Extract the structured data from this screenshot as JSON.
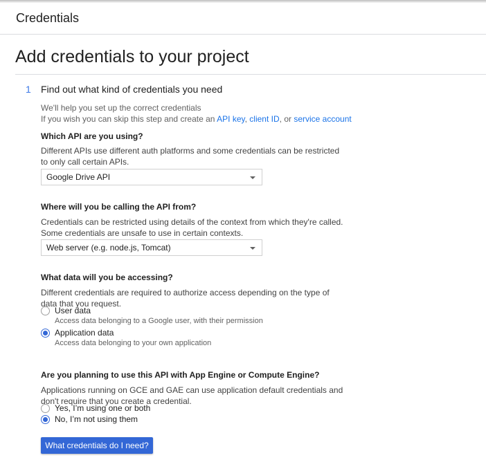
{
  "header": {
    "title": "Credentials"
  },
  "page": {
    "title": "Add credentials to your project"
  },
  "step": {
    "number": "1",
    "title": "Find out what kind of credentials you need"
  },
  "intro": {
    "line1": "We'll help you set up the correct credentials",
    "line2_prefix": "If you wish you can skip this step and create an ",
    "link_api_key": "API key",
    "sep1": ", ",
    "link_client_id": "client ID",
    "sep2": ", or ",
    "link_service_account": "service account"
  },
  "api_question": {
    "label": "Which API are you using?",
    "desc": "Different APIs use different auth platforms and some credentials can be restricted to only call certain APIs.",
    "selected": "Google Drive API"
  },
  "calling_question": {
    "label": "Where will you be calling the API from?",
    "desc": "Credentials can be restricted using details of the context from which they're called. Some credentials are unsafe to use in certain contexts.",
    "selected": "Web server (e.g. node.js, Tomcat)"
  },
  "data_question": {
    "label": "What data will you be accessing?",
    "desc": "Different credentials are required to authorize access depending on the type of data that you request.",
    "options": [
      {
        "label": "User data",
        "sub": "Access data belonging to a Google user, with their permission",
        "checked": false
      },
      {
        "label": "Application data",
        "sub": "Access data belonging to your own application",
        "checked": true
      }
    ]
  },
  "engine_question": {
    "label": "Are you planning to use this API with App Engine or Compute Engine?",
    "desc": "Applications running on GCE and GAE can use application default credentials and don't require that you create a credential.",
    "options": [
      {
        "label": "Yes, I’m using one or both",
        "checked": false
      },
      {
        "label": "No, I’m not using them",
        "checked": true
      }
    ]
  },
  "actions": {
    "primary_label": "What credentials do I need?"
  },
  "colors": {
    "accent": "#3367d6",
    "link": "#1a73e8",
    "step_number": "#3b78e7"
  }
}
